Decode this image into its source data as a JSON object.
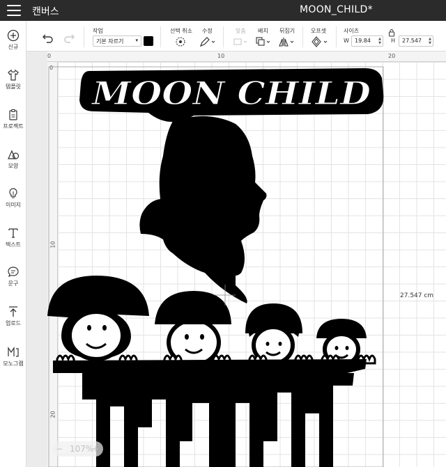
{
  "header": {
    "app_title": "캔버스",
    "doc_title": "MOON_CHILD*"
  },
  "sidebar": {
    "items": [
      {
        "label": "신규",
        "icon": "plus-circle-icon"
      },
      {
        "label": "템플릿",
        "icon": "shirt-icon"
      },
      {
        "label": "프로젝트",
        "icon": "project-icon"
      },
      {
        "label": "모양",
        "icon": "shapes-icon"
      },
      {
        "label": "이미지",
        "icon": "lightbulb-icon"
      },
      {
        "label": "텍스트",
        "icon": "text-t-icon"
      },
      {
        "label": "문구",
        "icon": "chat-bubble-icon"
      },
      {
        "label": "업로드",
        "icon": "upload-icon"
      },
      {
        "label": "모노그램",
        "icon": "monogram-icon"
      }
    ]
  },
  "toolbar": {
    "operation_label": "작업",
    "operation_value": "기본 자르기",
    "deselect_label": "선택 취소",
    "edit_label": "수정",
    "align_label": "맞춤",
    "arrange_label": "배치",
    "flip_label": "뒤집기",
    "offset_label": "오프셋",
    "size_label": "사이즈",
    "w_label": "W",
    "w_value": "19.84",
    "h_label": "H",
    "h_value": "27.547",
    "swatch_color": "#000000"
  },
  "canvas": {
    "ruler_top": [
      "0",
      "10",
      "20"
    ],
    "ruler_left": [
      "0",
      "10",
      "20"
    ],
    "height_readout": "27.547 cm",
    "zoom_value": "107%",
    "zoom_minus": "−",
    "zoom_plus": "+",
    "design_text": "MOON CHILD"
  }
}
